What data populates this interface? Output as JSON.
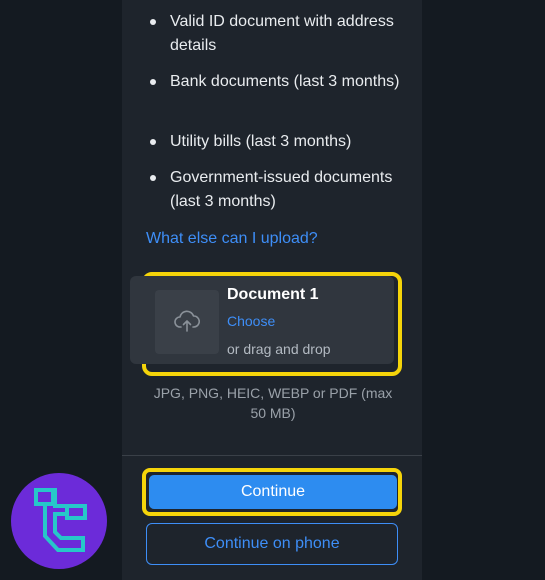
{
  "requirements": [
    "Valid ID document with address details",
    "Bank documents (last 3 months)",
    "Utility bills (last 3 months)",
    "Government-issued documents (last 3 months)"
  ],
  "help_link": "What else can I upload?",
  "upload": {
    "title": "Document 1",
    "choose_label": "Choose",
    "drag_text": "or drag and drop",
    "format_note": "JPG, PNG, HEIC, WEBP or PDF (max 50 MB)",
    "icon": "cloud-upload-icon"
  },
  "actions": {
    "continue_label": "Continue",
    "phone_label": "Continue on phone"
  },
  "overlay": {
    "brand_logo": "tc-logo-icon"
  },
  "colors": {
    "background": "#141a21",
    "panel": "#1e242c",
    "accent": "#2d8cf0",
    "link": "#3e8ef7",
    "highlight": "#f5d40a",
    "badge": "#6c2bd9"
  }
}
